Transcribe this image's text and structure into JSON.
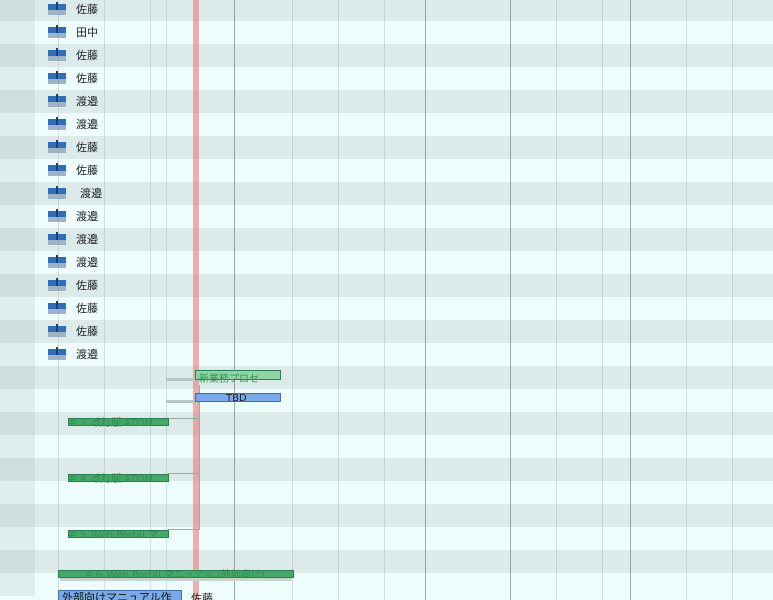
{
  "resources": [
    {
      "name": "佐藤"
    },
    {
      "name": "田中"
    },
    {
      "name": "佐藤"
    },
    {
      "name": "佐藤"
    },
    {
      "name": "渡邉"
    },
    {
      "name": "渡邉"
    },
    {
      "name": "佐藤"
    },
    {
      "name": "佐藤"
    },
    {
      "name": "渡邉"
    },
    {
      "name": "渡邉"
    },
    {
      "name": "渡邉"
    },
    {
      "name": "渡邉"
    },
    {
      "name": "佐藤"
    },
    {
      "name": "佐藤"
    },
    {
      "name": "佐藤"
    },
    {
      "name": "渡邉"
    }
  ],
  "tasks": {
    "new_business": "新業務プロセ",
    "tbd": "TBD",
    "t3": "＃３ 改訂版 ATOM",
    "t4": "＃４ 改訂版 ATOM",
    "t5": "＃５ Web Portal マ",
    "t6": "＃６ Web Portal マニュアル (外部向け)",
    "bottom_left": "外部向けマニュアル作",
    "bottom_right": "佐藤"
  },
  "colors": {
    "today_line": "#eb7878",
    "group_bar": "#43a86a",
    "task_bar": "#7aa9e8",
    "resource_icon": "#2f6fb8"
  }
}
